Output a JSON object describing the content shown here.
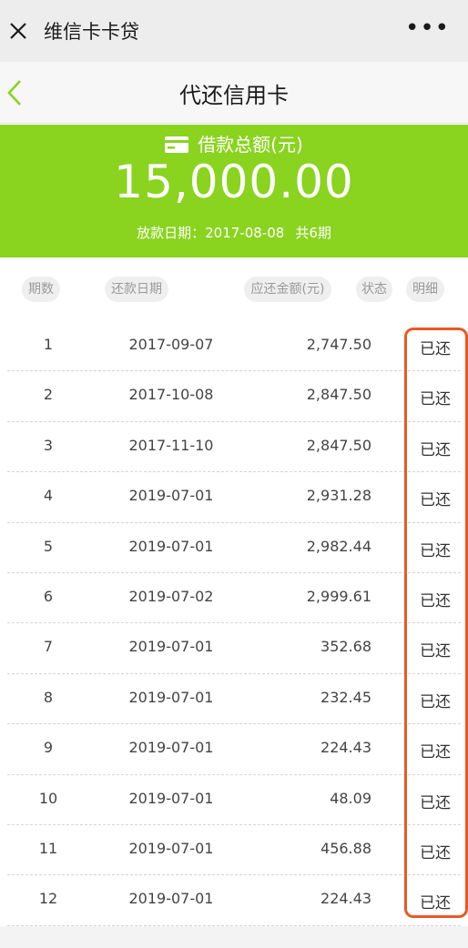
{
  "app": {
    "title": "维信卡卡贷",
    "close_icon": "close-icon",
    "more_icon": "more-dots-icon",
    "more_label": "•••"
  },
  "nav": {
    "title": "代还信用卡",
    "back_icon": "back-chevron-icon"
  },
  "summary": {
    "label": "借款总额(元)",
    "amount": "15,000.00",
    "date_text": "放款日期：2017-08-08",
    "period_text": "共6期",
    "accent_color": "#8ad31f"
  },
  "table": {
    "headers": {
      "period": "期数",
      "date": "还款日期",
      "amount": "应还金额(元)",
      "status": "状态",
      "detail": "明细"
    },
    "rows": [
      {
        "period": "1",
        "date": "2017-09-07",
        "amount": "2,747.50",
        "status": "已还"
      },
      {
        "period": "2",
        "date": "2017-10-08",
        "amount": "2,847.50",
        "status": "已还"
      },
      {
        "period": "3",
        "date": "2017-11-10",
        "amount": "2,847.50",
        "status": "已还"
      },
      {
        "period": "4",
        "date": "2019-07-01",
        "amount": "2,931.28",
        "status": "已还"
      },
      {
        "period": "5",
        "date": "2019-07-01",
        "amount": "2,982.44",
        "status": "已还"
      },
      {
        "period": "6",
        "date": "2019-07-02",
        "amount": "2,999.61",
        "status": "已还"
      },
      {
        "period": "7",
        "date": "2019-07-01",
        "amount": "352.68",
        "status": "已还"
      },
      {
        "period": "8",
        "date": "2019-07-01",
        "amount": "232.45",
        "status": "已还"
      },
      {
        "period": "9",
        "date": "2019-07-01",
        "amount": "224.43",
        "status": "已还"
      },
      {
        "period": "10",
        "date": "2019-07-01",
        "amount": "48.09",
        "status": "已还"
      },
      {
        "period": "11",
        "date": "2019-07-01",
        "amount": "456.88",
        "status": "已还"
      },
      {
        "period": "12",
        "date": "2019-07-01",
        "amount": "224.43",
        "status": "已还"
      }
    ]
  },
  "annotation_color": "#e75a25"
}
